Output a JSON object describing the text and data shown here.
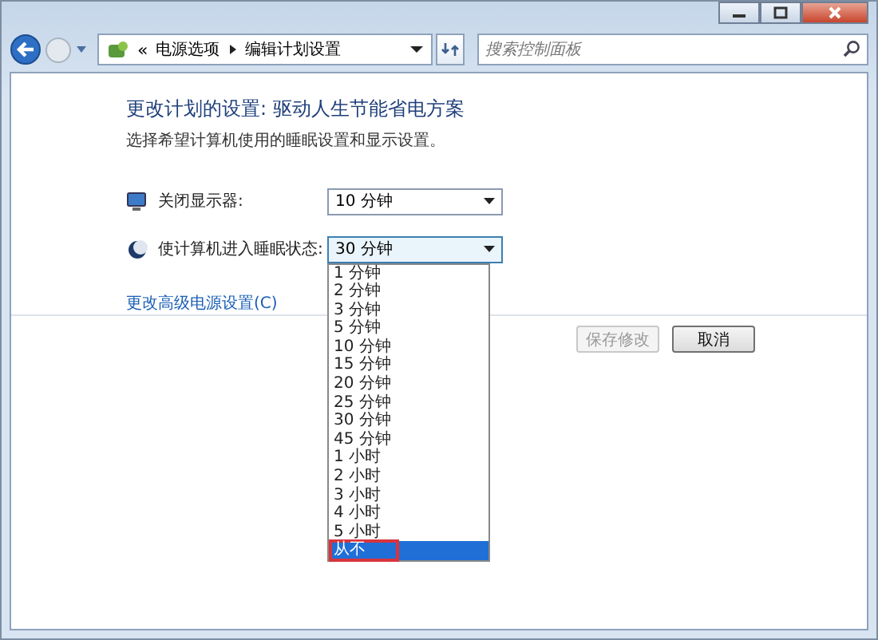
{
  "address_bar": {
    "overflow": "«",
    "path": [
      {
        "label": "电源选项"
      },
      {
        "label": "编辑计划设置"
      }
    ]
  },
  "search": {
    "placeholder": "搜索控制面板"
  },
  "heading": "更改计划的设置: 驱动人生节能省电方案",
  "subtitle": "选择希望计算机使用的睡眠设置和显示设置。",
  "settings": [
    {
      "kind": "display",
      "label": "关闭显示器:",
      "value": "10 分钟",
      "open": false
    },
    {
      "kind": "sleep",
      "label": "使计算机进入睡眠状态:",
      "value": "30 分钟",
      "open": true
    }
  ],
  "dropdown_options": [
    {
      "label": "1 分钟",
      "selected": false,
      "annotated": false
    },
    {
      "label": "2 分钟",
      "selected": false,
      "annotated": false
    },
    {
      "label": "3 分钟",
      "selected": false,
      "annotated": false
    },
    {
      "label": "5 分钟",
      "selected": false,
      "annotated": false
    },
    {
      "label": "10 分钟",
      "selected": false,
      "annotated": false
    },
    {
      "label": "15 分钟",
      "selected": false,
      "annotated": false
    },
    {
      "label": "20 分钟",
      "selected": false,
      "annotated": false
    },
    {
      "label": "25 分钟",
      "selected": false,
      "annotated": false
    },
    {
      "label": "30 分钟",
      "selected": false,
      "annotated": false
    },
    {
      "label": "45 分钟",
      "selected": false,
      "annotated": false
    },
    {
      "label": "1 小时",
      "selected": false,
      "annotated": false
    },
    {
      "label": "2 小时",
      "selected": false,
      "annotated": false
    },
    {
      "label": "3 小时",
      "selected": false,
      "annotated": false
    },
    {
      "label": "4 小时",
      "selected": false,
      "annotated": false
    },
    {
      "label": "5 小时",
      "selected": false,
      "annotated": false
    },
    {
      "label": "从不",
      "selected": true,
      "annotated": true
    }
  ],
  "link": "更改高级电源设置(C)",
  "buttons": [
    {
      "label": "保存修改",
      "disabled": true
    },
    {
      "label": "取消",
      "disabled": false
    }
  ]
}
